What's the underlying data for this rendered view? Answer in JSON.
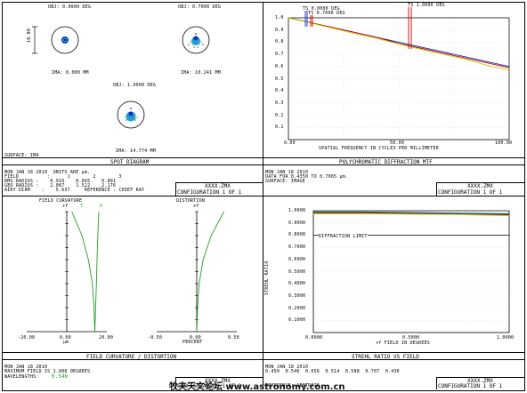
{
  "colors": {
    "blue": "#1030c0",
    "green": "#20a020",
    "red": "#c00000",
    "yellow": "#c8c800",
    "cyan": "#20a0d0"
  },
  "spot": {
    "title": "SPOT DIAGRAM",
    "obj1": "OBJ: 0.0000 DEG",
    "obj2": "OBJ: 0.7000 DEG",
    "obj3": "OBJ: 1.0000 DEG",
    "img1": "IMA: 0.000 MM",
    "img2": "IMA: 10.241 MM",
    "img3": "IMA: 14.774 MM",
    "scale": "10.00",
    "surface": "SURFACE: IMA",
    "info": [
      "MON JAN 18 2010  UNITS ARE µm.",
      "FIELD          :      1        2        3",
      "RMS RADIUS :    0.916    0.665    0.801",
      "GEO RADIUS :    2.087    1.522    2.176",
      "AIRY DIAM    :    5.637     REFERENCE : CHIEF RAY"
    ],
    "file": "XXXX.ZMX",
    "config": "CONFIGURATION 1 OF 1"
  },
  "mtf": {
    "title": "POLYCHROMATIC DIFFRACTION MTF",
    "ts1": "TS 0.0000 DEG",
    "ts2": "TS 0.7000 DEG",
    "ts3": "TS 1.0000 DEG",
    "xlabel": "SPATIAL FREQUENCY IN CYCLES PER MILLIMETER",
    "info": [
      "MON JAN 18 2010",
      "DATA FOR 0.4350 TO 0.7065 µm.",
      "SURFACE: IMAGE"
    ],
    "file": "XXXX.ZMX",
    "config": "CONFIGURATION 1 OF 1"
  },
  "fc": {
    "title": "FIELD CURVATURE / DISTORTION",
    "left_title": "FIELD CURVATURE",
    "right_title": "DISTORTION",
    "plusy": "+Y",
    "t_label": "T",
    "s_label": "S",
    "left_unit": "µm",
    "right_unit": "PERCENT",
    "info": [
      "MON JAN 18 2010",
      "MAXIMUM FIELD IS 1.000 DEGREES",
      "WAVELENGTHS:"
    ],
    "wavelength": "0.546",
    "file": "XXXX.ZMX",
    "config": "CONFIGURATION 1 OF 1"
  },
  "strehl": {
    "title": "STREHL RATIO VS FIELD",
    "ylabel": "STREHL RATIO",
    "xlabel": "+Y FIELD IN DEGREES",
    "diff_limit": "DIFFRACTION LIMIT",
    "info": [
      "MON JAN 18 2010",
      "0.450  0.546  0.656  0.514  0.588  0.707  0.436",
      "REFERENCE: CENTROID"
    ],
    "file": "XXXX.ZMX",
    "config": "CONFIGURATION 1 OF 1"
  },
  "watermark": "牧夫天文论坛 www.astronomy.com.cn",
  "chart_data": [
    {
      "type": "line",
      "title": "POLYCHROMATIC DIFFRACTION MTF",
      "xlabel": "SPATIAL FREQUENCY IN CYCLES PER MILLIMETER",
      "ylabel": "",
      "xlim": [
        0,
        100
      ],
      "ylim": [
        0,
        1
      ],
      "x_ticks": [
        "0.00",
        "50.00",
        "100.00"
      ],
      "y_ticks": [
        "0.1",
        "0.2",
        "0.3",
        "0.4",
        "0.5",
        "0.6",
        "0.7",
        "0.8",
        "0.9",
        "1.0"
      ],
      "x": [
        0,
        10,
        20,
        30,
        40,
        50,
        60,
        70,
        80,
        90,
        100
      ],
      "series": [
        {
          "name": "TS 0.0000 DEG",
          "color": "#1030c0",
          "values": [
            1.0,
            0.96,
            0.92,
            0.88,
            0.84,
            0.8,
            0.76,
            0.72,
            0.68,
            0.64,
            0.6
          ]
        },
        {
          "name": "TS 0.7000 DEG",
          "color": "#c00000",
          "values": [
            1.0,
            0.96,
            0.92,
            0.88,
            0.84,
            0.79,
            0.75,
            0.71,
            0.67,
            0.63,
            0.59
          ]
        },
        {
          "name": "TS 1.0000 DEG",
          "color": "#c8c800",
          "values": [
            1.0,
            0.958,
            0.915,
            0.87,
            0.83,
            0.785,
            0.74,
            0.7,
            0.66,
            0.61,
            0.57
          ]
        }
      ]
    },
    {
      "type": "line",
      "title": "FIELD CURVATURE",
      "xlim": [
        -20,
        20
      ],
      "ylim": [
        0,
        1
      ],
      "x_ticks": [
        "-20.00",
        "0.00",
        "20.00"
      ],
      "x_unit": "µm",
      "series": [
        {
          "name": "T",
          "y": [
            0,
            0.2,
            0.4,
            0.6,
            0.8,
            1.0
          ],
          "x": [
            14,
            13.6,
            12.8,
            10.8,
            7.6,
            2.5
          ]
        },
        {
          "name": "S",
          "y": [
            0,
            0.2,
            0.4,
            0.6,
            0.8,
            1.0
          ],
          "x": [
            14,
            14.4,
            14.8,
            15.1,
            15.5,
            16.0
          ]
        }
      ]
    },
    {
      "type": "line",
      "title": "DISTORTION",
      "xlim": [
        -0.5,
        0.5
      ],
      "ylim": [
        0,
        1
      ],
      "x_ticks": [
        "-0.50",
        "0.00",
        "0.50"
      ],
      "x_unit": "PERCENT",
      "series": [
        {
          "name": "DISTORTION",
          "y": [
            0,
            0.2,
            0.4,
            0.6,
            0.8,
            1.0
          ],
          "x": [
            0,
            0.01,
            0.03,
            0.08,
            0.18,
            0.34
          ]
        }
      ]
    },
    {
      "type": "line",
      "title": "STREHL RATIO VS FIELD",
      "xlabel": "+Y FIELD IN DEGREES",
      "ylabel": "STREHL RATIO",
      "xlim": [
        0,
        1
      ],
      "ylim": [
        0,
        1
      ],
      "x_ticks": [
        "0.0000",
        "0.5000",
        "1.0000"
      ],
      "y_ticks": [
        "0.1000",
        "0.2000",
        "0.3000",
        "0.4000",
        "0.5000",
        "0.6000",
        "0.7000",
        "0.8000",
        "0.9000",
        "1.0000"
      ],
      "diffraction_limit": 0.8,
      "x": [
        0,
        0.25,
        0.5,
        0.75,
        1.0
      ],
      "series": [
        {
          "name": "1",
          "color": "#1030c0",
          "values": [
            0.99,
            0.99,
            0.985,
            0.98,
            0.975
          ]
        },
        {
          "name": "2",
          "color": "#20a020",
          "values": [
            0.985,
            0.985,
            0.98,
            0.975,
            0.97
          ]
        },
        {
          "name": "3",
          "color": "#c00000",
          "values": [
            0.98,
            0.98,
            0.975,
            0.97,
            0.965
          ]
        },
        {
          "name": "4",
          "color": "#c8c800",
          "values": [
            0.975,
            0.975,
            0.972,
            0.968,
            0.96
          ]
        }
      ]
    }
  ]
}
